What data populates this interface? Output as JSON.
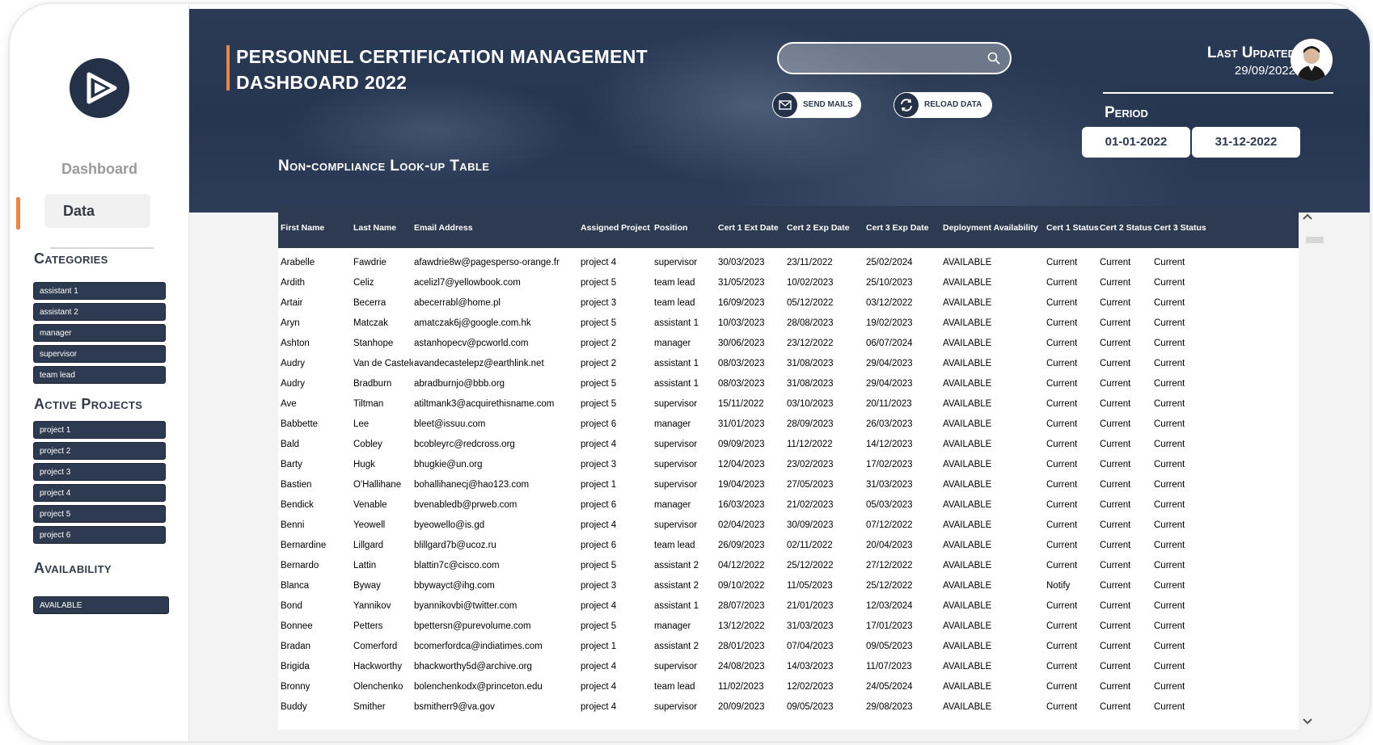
{
  "sidebar": {
    "nav": [
      {
        "label": "Dashboard"
      },
      {
        "label": "Data"
      }
    ],
    "categories_heading": "Categories",
    "categories": [
      "assistant 1",
      "assistant 2",
      "manager",
      "supervisor",
      "team lead"
    ],
    "projects_heading": "Active Projects",
    "projects": [
      "project 1",
      "project 2",
      "project 3",
      "project 4",
      "project 5",
      "project 6"
    ],
    "availability_heading": "Availability",
    "availability": [
      "AVAILABLE"
    ]
  },
  "header": {
    "title": "PERSONNEL CERTIFICATION MANAGEMENT DASHBOARD 2022",
    "subtitle": "Non-compliance Look-up Table",
    "search_value": "",
    "send_mails_label": "SEND MAILS",
    "reload_label": "RELOAD DATA",
    "last_updated_label": "Last Updated",
    "last_updated_date": "29/09/2022",
    "period_label": "Period",
    "period_start": "01-01-2022",
    "period_end": "31-12-2022"
  },
  "colors": {
    "navy": "#2e3a4f",
    "accent": "#e8864a",
    "banner": "#263550"
  },
  "icons": [
    "logo-icon",
    "search-icon",
    "mail-icon",
    "reload-icon",
    "user-avatar",
    "chevron-up-icon",
    "chevron-down-icon"
  ],
  "table": {
    "columns": [
      "First Name",
      "Last Name",
      "Email Address",
      "Assigned Project",
      "Position",
      "Cert 1 Ext Date",
      "Cert 2 Exp Date",
      "Cert 3 Exp Date",
      "Deployment Availability",
      "Cert 1 Status",
      "Cert 2 Status",
      "Cert 3 Status"
    ],
    "rows": [
      [
        "Arabelle",
        "Fawdrie",
        "afawdrie8w@pagesperso-orange.fr",
        "project 4",
        "supervisor",
        "30/03/2023",
        "23/11/2022",
        "25/02/2024",
        "AVAILABLE",
        "Current",
        "Current",
        "Current"
      ],
      [
        "Ardith",
        "Celiz",
        "acelizl7@yellowbook.com",
        "project 5",
        "team lead",
        "31/05/2023",
        "10/02/2023",
        "25/10/2023",
        "AVAILABLE",
        "Current",
        "Current",
        "Current"
      ],
      [
        "Artair",
        "Becerra",
        "abecerrabl@home.pl",
        "project 3",
        "team lead",
        "16/09/2023",
        "05/12/2022",
        "03/12/2022",
        "AVAILABLE",
        "Current",
        "Current",
        "Current"
      ],
      [
        "Aryn",
        "Matczak",
        "amatczak6j@google.com.hk",
        "project 5",
        "assistant 1",
        "10/03/2023",
        "28/08/2023",
        "19/02/2023",
        "AVAILABLE",
        "Current",
        "Current",
        "Current"
      ],
      [
        "Ashton",
        "Stanhope",
        "astanhopecv@pcworld.com",
        "project 2",
        "manager",
        "30/06/2023",
        "23/12/2022",
        "06/07/2024",
        "AVAILABLE",
        "Current",
        "Current",
        "Current"
      ],
      [
        "Audry",
        "Van de Castele",
        "avandecastelepz@earthlink.net",
        "project 2",
        "assistant 1",
        "08/03/2023",
        "31/08/2023",
        "29/04/2023",
        "AVAILABLE",
        "Current",
        "Current",
        "Current"
      ],
      [
        "Audry",
        "Bradburn",
        "abradburnjo@bbb.org",
        "project 5",
        "assistant 1",
        "08/03/2023",
        "31/08/2023",
        "29/04/2023",
        "AVAILABLE",
        "Current",
        "Current",
        "Current"
      ],
      [
        "Ave",
        "Tiltman",
        "atiltmank3@acquirethisname.com",
        "project 5",
        "supervisor",
        "15/11/2022",
        "03/10/2023",
        "20/11/2023",
        "AVAILABLE",
        "Current",
        "Current",
        "Current"
      ],
      [
        "Babbette",
        "Lee",
        "bleet@issuu.com",
        "project 6",
        "manager",
        "31/01/2023",
        "28/09/2023",
        "26/03/2023",
        "AVAILABLE",
        "Current",
        "Current",
        "Current"
      ],
      [
        "Bald",
        "Cobley",
        "bcobleyrc@redcross.org",
        "project 4",
        "supervisor",
        "09/09/2023",
        "11/12/2022",
        "14/12/2023",
        "AVAILABLE",
        "Current",
        "Current",
        "Current"
      ],
      [
        "Barty",
        "Hugk",
        "bhugkie@un.org",
        "project 3",
        "supervisor",
        "12/04/2023",
        "23/02/2023",
        "17/02/2023",
        "AVAILABLE",
        "Current",
        "Current",
        "Current"
      ],
      [
        "Bastien",
        "O'Hallihane",
        "bohallihanecj@hao123.com",
        "project 1",
        "supervisor",
        "19/04/2023",
        "27/05/2023",
        "31/03/2023",
        "AVAILABLE",
        "Current",
        "Current",
        "Current"
      ],
      [
        "Bendick",
        "Venable",
        "bvenabledb@prweb.com",
        "project 6",
        "manager",
        "16/03/2023",
        "21/02/2023",
        "05/03/2023",
        "AVAILABLE",
        "Current",
        "Current",
        "Current"
      ],
      [
        "Benni",
        "Yeowell",
        "byeowello@is.gd",
        "project 4",
        "supervisor",
        "02/04/2023",
        "30/09/2023",
        "07/12/2022",
        "AVAILABLE",
        "Current",
        "Current",
        "Current"
      ],
      [
        "Bernardine",
        "Lillgard",
        "blillgard7b@ucoz.ru",
        "project 6",
        "team lead",
        "26/09/2023",
        "02/11/2022",
        "20/04/2023",
        "AVAILABLE",
        "Current",
        "Current",
        "Current"
      ],
      [
        "Bernardo",
        "Lattin",
        "blattin7c@cisco.com",
        "project 5",
        "assistant 2",
        "04/12/2022",
        "25/12/2022",
        "27/12/2022",
        "AVAILABLE",
        "Current",
        "Current",
        "Current"
      ],
      [
        "Blanca",
        "Byway",
        "bbywayct@ihg.com",
        "project 3",
        "assistant 2",
        "09/10/2022",
        "11/05/2023",
        "25/12/2022",
        "AVAILABLE",
        "Notify",
        "Current",
        "Current"
      ],
      [
        "Bond",
        "Yannikov",
        "byannikovbi@twitter.com",
        "project 4",
        "assistant 1",
        "28/07/2023",
        "21/01/2023",
        "12/03/2024",
        "AVAILABLE",
        "Current",
        "Current",
        "Current"
      ],
      [
        "Bonnee",
        "Petters",
        "bpettersn@purevolume.com",
        "project 5",
        "manager",
        "13/12/2022",
        "31/03/2023",
        "17/01/2023",
        "AVAILABLE",
        "Current",
        "Current",
        "Current"
      ],
      [
        "Bradan",
        "Comerford",
        "bcomerfordca@indiatimes.com",
        "project 1",
        "assistant 2",
        "28/01/2023",
        "07/04/2023",
        "09/05/2023",
        "AVAILABLE",
        "Current",
        "Current",
        "Current"
      ],
      [
        "Brigida",
        "Hackworthy",
        "bhackworthy5d@archive.org",
        "project 4",
        "supervisor",
        "24/08/2023",
        "14/03/2023",
        "11/07/2023",
        "AVAILABLE",
        "Current",
        "Current",
        "Current"
      ],
      [
        "Bronny",
        "Olenchenko",
        "bolenchenkodx@princeton.edu",
        "project 4",
        "team lead",
        "11/02/2023",
        "12/02/2023",
        "24/05/2024",
        "AVAILABLE",
        "Current",
        "Current",
        "Current"
      ],
      [
        "Buddy",
        "Smither",
        "bsmitherr9@va.gov",
        "project 4",
        "supervisor",
        "20/09/2023",
        "09/05/2023",
        "29/08/2023",
        "AVAILABLE",
        "Current",
        "Current",
        "Current"
      ]
    ]
  }
}
